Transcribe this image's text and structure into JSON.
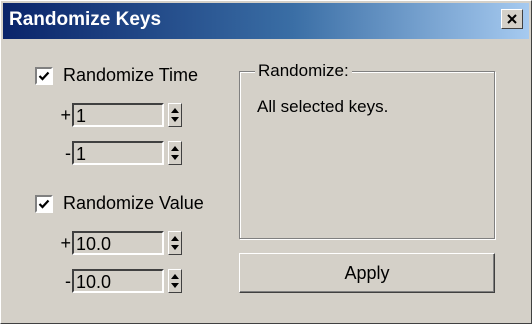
{
  "window": {
    "title": "Randomize Keys",
    "close_icon": "close-icon"
  },
  "time": {
    "checkbox_label": "Randomize Time",
    "checked": true,
    "plus_sign": "+",
    "plus_value": "1",
    "minus_sign": "-",
    "minus_value": "1"
  },
  "value": {
    "checkbox_label": "Randomize Value",
    "checked": true,
    "plus_sign": "+",
    "plus_value": "10.0",
    "minus_sign": "-",
    "minus_value": "10.0"
  },
  "randomize_group": {
    "legend": "Randomize:",
    "text": "All selected keys."
  },
  "apply_label": "Apply"
}
